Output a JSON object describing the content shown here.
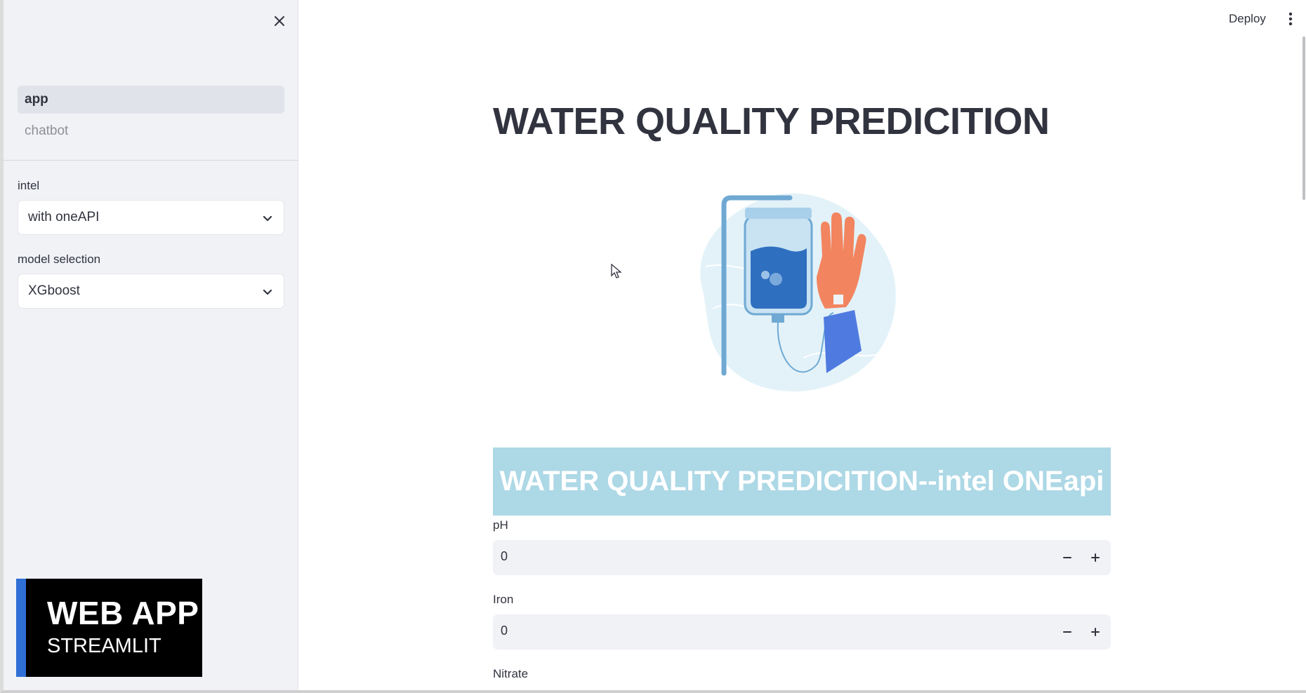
{
  "sidebar": {
    "nav_items": [
      {
        "label": "app",
        "active": true
      },
      {
        "label": "chatbot",
        "active": false
      }
    ],
    "intel": {
      "label": "intel",
      "value": "with oneAPI"
    },
    "model": {
      "label": "model selection",
      "value": "XGboost"
    },
    "banner": {
      "line1": "WEB APP",
      "line2": "STREAMLIT"
    },
    "icons": {
      "close": "close-icon",
      "chevron": "chevron-down-icon"
    }
  },
  "toolbar": {
    "deploy_label": "Deploy",
    "menu_icon": "more-vertical-icon"
  },
  "main": {
    "title": "WATER QUALITY PREDICITION",
    "header_box": "WATER QUALITY PREDICITION--intel ONEapi",
    "illustration_icon": "iv-drip-hand-illustration",
    "fields": [
      {
        "label": "pH",
        "value": "0"
      },
      {
        "label": "Iron",
        "value": "0"
      },
      {
        "label": "Nitrate"
      }
    ]
  },
  "colors": {
    "sidebar_bg": "#f0f2f6",
    "header_box_bg": "#add8e6",
    "banner_bg": "#000000",
    "banner_accent": "#2f6fd6",
    "input_bg": "#f0f2f6"
  }
}
